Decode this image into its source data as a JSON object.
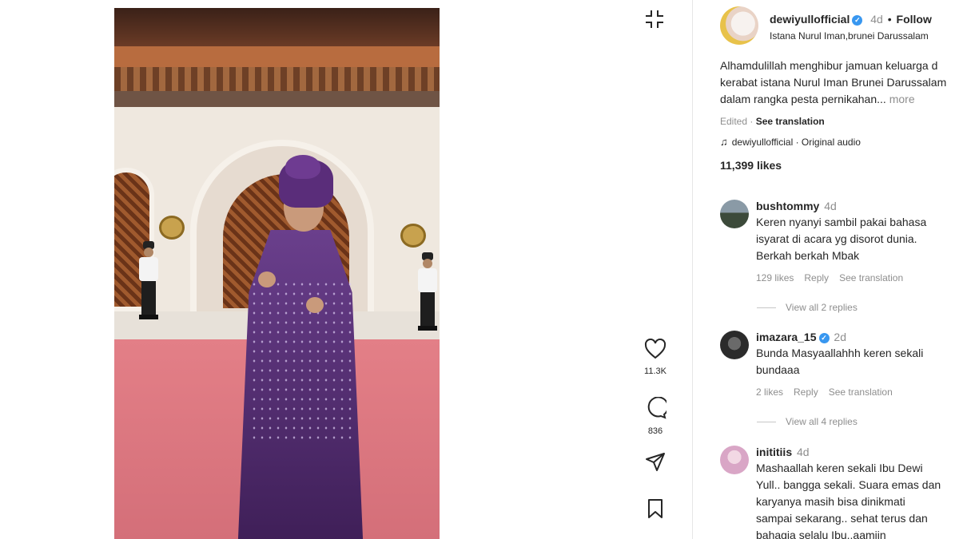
{
  "post": {
    "username": "dewiyullofficial",
    "time": "4d",
    "separator": "•",
    "follow_label": "Follow",
    "location": "Istana Nurul Iman,brunei Darussalam",
    "caption_line1": "Alhamdulillah menghibur jamuan keluarga d",
    "caption_line2": "kerabat istana Nurul Iman Brunei Darussalam",
    "caption_line3": "dalam rangka pesta pernikahan...",
    "more_label": "more",
    "edited_label": "Edited",
    "edited_sep": "·",
    "see_translation": "See translation",
    "audio_label": "dewiyullofficial · Original audio",
    "likes": "11,399 likes"
  },
  "actions": {
    "like_count": "11.3K",
    "comment_count": "836"
  },
  "comments": [
    {
      "username": "bushtommy",
      "time": "4d",
      "verified": false,
      "text_lines": [
        "Keren nyanyi sambil pakai bahasa",
        "isyarat di acara yg disorot dunia.",
        "Berkah berkah Mbak"
      ],
      "likes": "129 likes",
      "reply": "Reply",
      "translation": "See translation",
      "view_replies": "View all 2 replies"
    },
    {
      "username": "imazara_15",
      "time": "2d",
      "verified": true,
      "text_lines": [
        "Bunda Masyaallahhh keren sekali",
        "bundaaa"
      ],
      "likes": "2 likes",
      "reply": "Reply",
      "translation": "See translation",
      "view_replies": "View all 4 replies"
    },
    {
      "username": "inititiis",
      "time": "4d",
      "verified": false,
      "text_lines": [
        "Mashaallah keren sekali Ibu Dewi",
        "Yull.. bangga sekali. Suara emas dan",
        "karyanya masih bisa dinikmati",
        "sampai sekarang.. sehat terus dan",
        "bahagia selalu Ibu..aamiin"
      ]
    }
  ],
  "icons": {
    "verified": "✓",
    "music": "♫"
  }
}
